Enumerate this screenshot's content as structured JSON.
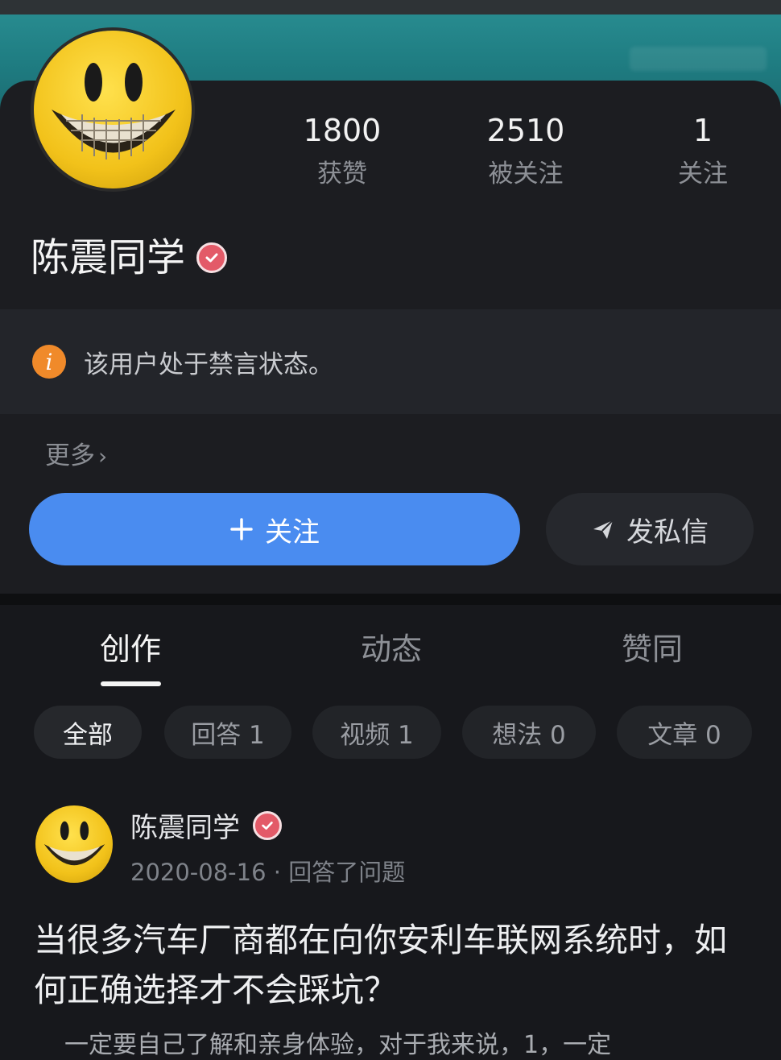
{
  "profile": {
    "name": "陈震同学",
    "stats": [
      {
        "value": "1800",
        "label": "获赞"
      },
      {
        "value": "2510",
        "label": "被关注"
      },
      {
        "value": "1",
        "label": "关注"
      }
    ],
    "notice": "该用户处于禁言状态。",
    "more_label": "更多",
    "follow_label": "关注",
    "dm_label": "发私信"
  },
  "tabs": [
    {
      "label": "创作",
      "active": true
    },
    {
      "label": "动态",
      "active": false
    },
    {
      "label": "赞同",
      "active": false
    }
  ],
  "filters": [
    {
      "label": "全部",
      "active": true
    },
    {
      "label": "回答 1",
      "active": false
    },
    {
      "label": "视频 1",
      "active": false
    },
    {
      "label": "想法 0",
      "active": false
    },
    {
      "label": "文章 0",
      "active": false
    }
  ],
  "post": {
    "author": "陈震同学",
    "date": "2020-08-16",
    "action": "回答了问题",
    "title": "当很多汽车厂商都在向你安利车联网系统时，如何正确选择才不会踩坑？",
    "excerpt": "一定要自己了解和亲身体验，对于我来说，1，一定"
  },
  "colors": {
    "accent": "#4a8cf0",
    "warning": "#f08a2a",
    "verify_badge": "#e35a68"
  },
  "icons": {
    "verify": "verified-badge-icon",
    "info": "info-icon",
    "send": "paper-plane-icon",
    "plus": "plus-icon",
    "chevron": "chevron-right-icon"
  }
}
